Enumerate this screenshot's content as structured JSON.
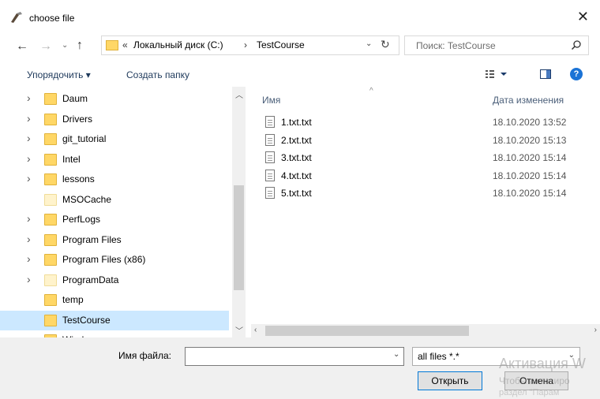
{
  "window": {
    "title": "choose file",
    "close_glyph": "✕"
  },
  "nav": {
    "back_glyph": "←",
    "forward_glyph": "→",
    "history_glyph": "⌄",
    "up_glyph": "↑"
  },
  "address": {
    "overflow": "«",
    "crumbs": [
      "Локальный диск (C:)",
      "TestCourse"
    ],
    "separator": "›",
    "dropdown_glyph": "⌄",
    "refresh_glyph": "↻"
  },
  "search": {
    "placeholder": "Поиск: TestCourse",
    "icon": "search-icon"
  },
  "toolbar": {
    "organize_label": "Упорядочить ▾",
    "new_folder_label": "Создать папку",
    "help_glyph": "?"
  },
  "tree": {
    "items": [
      {
        "label": "Daum",
        "has_children": true,
        "light": false,
        "selected": false
      },
      {
        "label": "Drivers",
        "has_children": true,
        "light": false,
        "selected": false
      },
      {
        "label": "git_tutorial",
        "has_children": true,
        "light": false,
        "selected": false
      },
      {
        "label": "Intel",
        "has_children": true,
        "light": false,
        "selected": false
      },
      {
        "label": "lessons",
        "has_children": true,
        "light": false,
        "selected": false
      },
      {
        "label": "MSOCache",
        "has_children": false,
        "light": true,
        "selected": false
      },
      {
        "label": "PerfLogs",
        "has_children": true,
        "light": false,
        "selected": false
      },
      {
        "label": "Program Files",
        "has_children": true,
        "light": false,
        "selected": false
      },
      {
        "label": "Program Files (x86)",
        "has_children": true,
        "light": false,
        "selected": false
      },
      {
        "label": "ProgramData",
        "has_children": true,
        "light": true,
        "selected": false
      },
      {
        "label": "temp",
        "has_children": false,
        "light": false,
        "selected": false
      },
      {
        "label": "TestCourse",
        "has_children": false,
        "light": false,
        "selected": true
      },
      {
        "label": "Windows",
        "has_children": true,
        "light": false,
        "selected": false
      }
    ]
  },
  "files": {
    "col_name": "Имя",
    "col_date": "Дата изменения",
    "sort_glyph": "^",
    "rows": [
      {
        "name": "1.txt.txt",
        "date": "18.10.2020 13:52"
      },
      {
        "name": "2.txt.txt",
        "date": "18.10.2020 15:13"
      },
      {
        "name": "3.txt.txt",
        "date": "18.10.2020 15:14"
      },
      {
        "name": "4.txt.txt",
        "date": "18.10.2020 15:14"
      },
      {
        "name": "5.txt.txt",
        "date": "18.10.2020 15:14"
      }
    ]
  },
  "footer": {
    "filename_label": "Имя файла:",
    "filename_value": "",
    "filter_value": "all files *.*",
    "open_label": "Открыть",
    "cancel_label": "Отмена",
    "watermark_title": "Активация W",
    "watermark_line1": "Чтобы активиро",
    "watermark_line2": "раздел \"Парам"
  }
}
